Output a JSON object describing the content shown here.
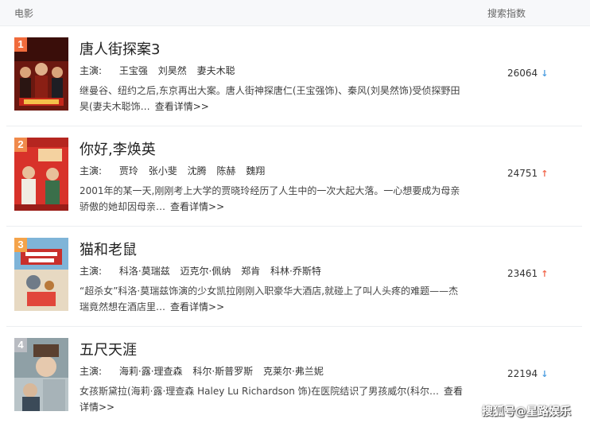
{
  "header": {
    "left": "电影",
    "right": "搜索指数"
  },
  "items": [
    {
      "rank": "1",
      "rank_color": "#f06b3c",
      "title": "唐人街探案3",
      "cast_label": "主演:",
      "actors": [
        "王宝强",
        "刘昊然",
        "妻夫木聪"
      ],
      "desc": "继曼谷、纽约之后,东京再出大案。唐人街神探唐仁(王宝强饰)、秦风(刘昊然饰)受侦探野田昊(妻夫木聪饰…",
      "more": "查看详情>>",
      "score": "26064",
      "trend": "down"
    },
    {
      "rank": "2",
      "rank_color": "#f08a4b",
      "title": "你好,李焕英",
      "cast_label": "主演:",
      "actors": [
        "贾玲",
        "张小斐",
        "沈腾",
        "陈赫",
        "魏翔"
      ],
      "desc": "2001年的某一天,刚刚考上大学的贾晓玲经历了人生中的一次大起大落。一心想要成为母亲骄傲的她却因母亲…",
      "more": "查看详情>>",
      "score": "24751",
      "trend": "up"
    },
    {
      "rank": "3",
      "rank_color": "#f4a34a",
      "title": "猫和老鼠",
      "cast_label": "主演:",
      "actors": [
        "科洛·莫瑞兹",
        "迈克尔·佩纳",
        "郑肯",
        "科林·乔斯特"
      ],
      "desc": "“超杀女”科洛·莫瑞兹饰演的少女凯拉刚刚入职豪华大酒店,就碰上了叫人头疼的难题——杰瑞竟然想在酒店里…",
      "more": "查看详情>>",
      "score": "23461",
      "trend": "up"
    },
    {
      "rank": "4",
      "rank_color": "#b9bcc2",
      "title": "五尺天涯",
      "cast_label": "主演:",
      "actors": [
        "海莉·露·理查森",
        "科尔·斯普罗斯",
        "克莱尔·弗兰妮"
      ],
      "desc": "女孩斯黛拉(海莉·露·理查森 Haley Lu Richardson 饰)在医院结识了男孩威尔(科尔…",
      "more": "查看详情>>",
      "score": "22194",
      "trend": "down"
    }
  ],
  "watermark": "搜狐号@星路娱乐"
}
